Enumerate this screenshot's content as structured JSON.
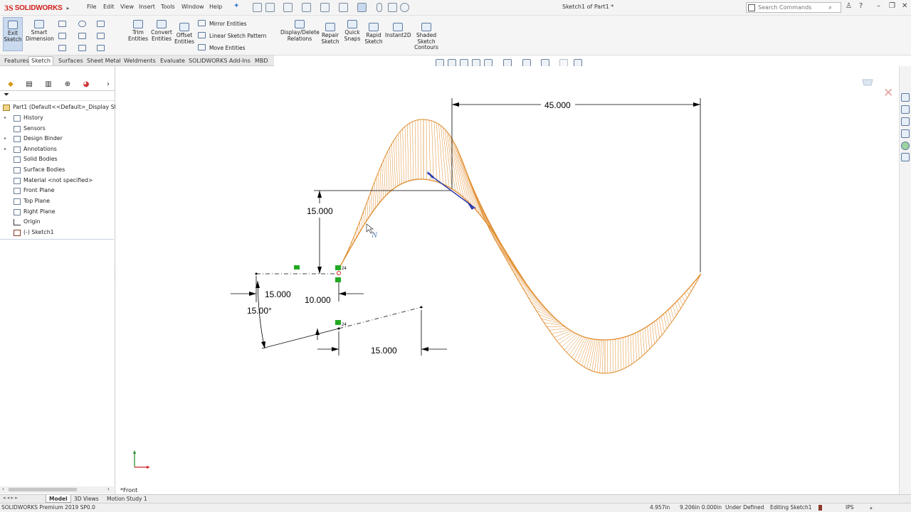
{
  "titlebar": {
    "app_name": "SOLIDWORKS",
    "menu": [
      "File",
      "Edit",
      "View",
      "Insert",
      "Tools",
      "Window",
      "Help"
    ],
    "document_title": "Sketch1 of Part1 *",
    "search_placeholder": "Search Commands"
  },
  "ribbon": {
    "exit_sketch": "Exit Sketch",
    "smart_dimension": "Smart Dimension",
    "trim_entities": "Trim Entities",
    "convert_entities": "Convert Entities",
    "offset_entities": "Offset Entities",
    "mirror_entities": "Mirror Entities",
    "linear_sketch_pattern": "Linear Sketch Pattern",
    "move_entities": "Move Entities",
    "display_delete_relations": "Display/Delete Relations",
    "repair_sketch": "Repair Sketch",
    "quick_snaps": "Quick Snaps",
    "rapid_sketch": "Rapid Sketch",
    "instant2d": "Instant2D",
    "shaded_sketch_contours": "Shaded Sketch Contours"
  },
  "command_tabs": [
    {
      "label": "Features",
      "active": false
    },
    {
      "label": "Sketch",
      "active": true
    },
    {
      "label": "Surfaces",
      "active": false
    },
    {
      "label": "Sheet Metal",
      "active": false
    },
    {
      "label": "Weldments",
      "active": false
    },
    {
      "label": "Evaluate",
      "active": false
    },
    {
      "label": "SOLIDWORKS Add-Ins",
      "active": false
    },
    {
      "label": "MBD",
      "active": false
    }
  ],
  "feature_tree": {
    "root": "Part1  (Default<<Default>_Display State",
    "items": [
      {
        "label": "History",
        "expandable": true,
        "icon": "history-folder-icon"
      },
      {
        "label": "Sensors",
        "expandable": false,
        "icon": "sensors-icon"
      },
      {
        "label": "Design Binder",
        "expandable": true,
        "icon": "design-binder-icon"
      },
      {
        "label": "Annotations",
        "expandable": true,
        "icon": "annotations-icon"
      },
      {
        "label": "Solid Bodies",
        "expandable": false,
        "icon": "solid-bodies-icon"
      },
      {
        "label": "Surface Bodies",
        "expandable": false,
        "icon": "surface-bodies-icon"
      },
      {
        "label": "Material <not specified>",
        "expandable": false,
        "icon": "material-icon"
      },
      {
        "label": "Front Plane",
        "expandable": false,
        "icon": "plane-icon"
      },
      {
        "label": "Top Plane",
        "expandable": false,
        "icon": "plane-icon"
      },
      {
        "label": "Right Plane",
        "expandable": false,
        "icon": "plane-icon"
      },
      {
        "label": "Origin",
        "expandable": false,
        "icon": "origin-icon"
      },
      {
        "label": "(-) Sketch1",
        "expandable": false,
        "icon": "sketch-icon"
      }
    ]
  },
  "sketch": {
    "dimensions": {
      "top_width": "45.000",
      "height": "15.000",
      "left_offset": "15.000",
      "angle": "15.00°",
      "gap": "10.000",
      "bottom": "15.000"
    },
    "view_label": "*Front",
    "curve_color": "#e08a2a",
    "relation_color": "#22aa22",
    "selection_color": "#2a3ab0"
  },
  "bottom_tabs": [
    {
      "label": "Model",
      "active": true
    },
    {
      "label": "3D Views",
      "active": false
    },
    {
      "label": "Motion Study 1",
      "active": false
    }
  ],
  "status": {
    "product": "SOLIDWORKS Premium 2019 SP0.0",
    "x": "4.957in",
    "y_z": "9.206in 0.000in",
    "state": "Under Defined",
    "editing": "Editing Sketch1",
    "units": "IPS"
  }
}
